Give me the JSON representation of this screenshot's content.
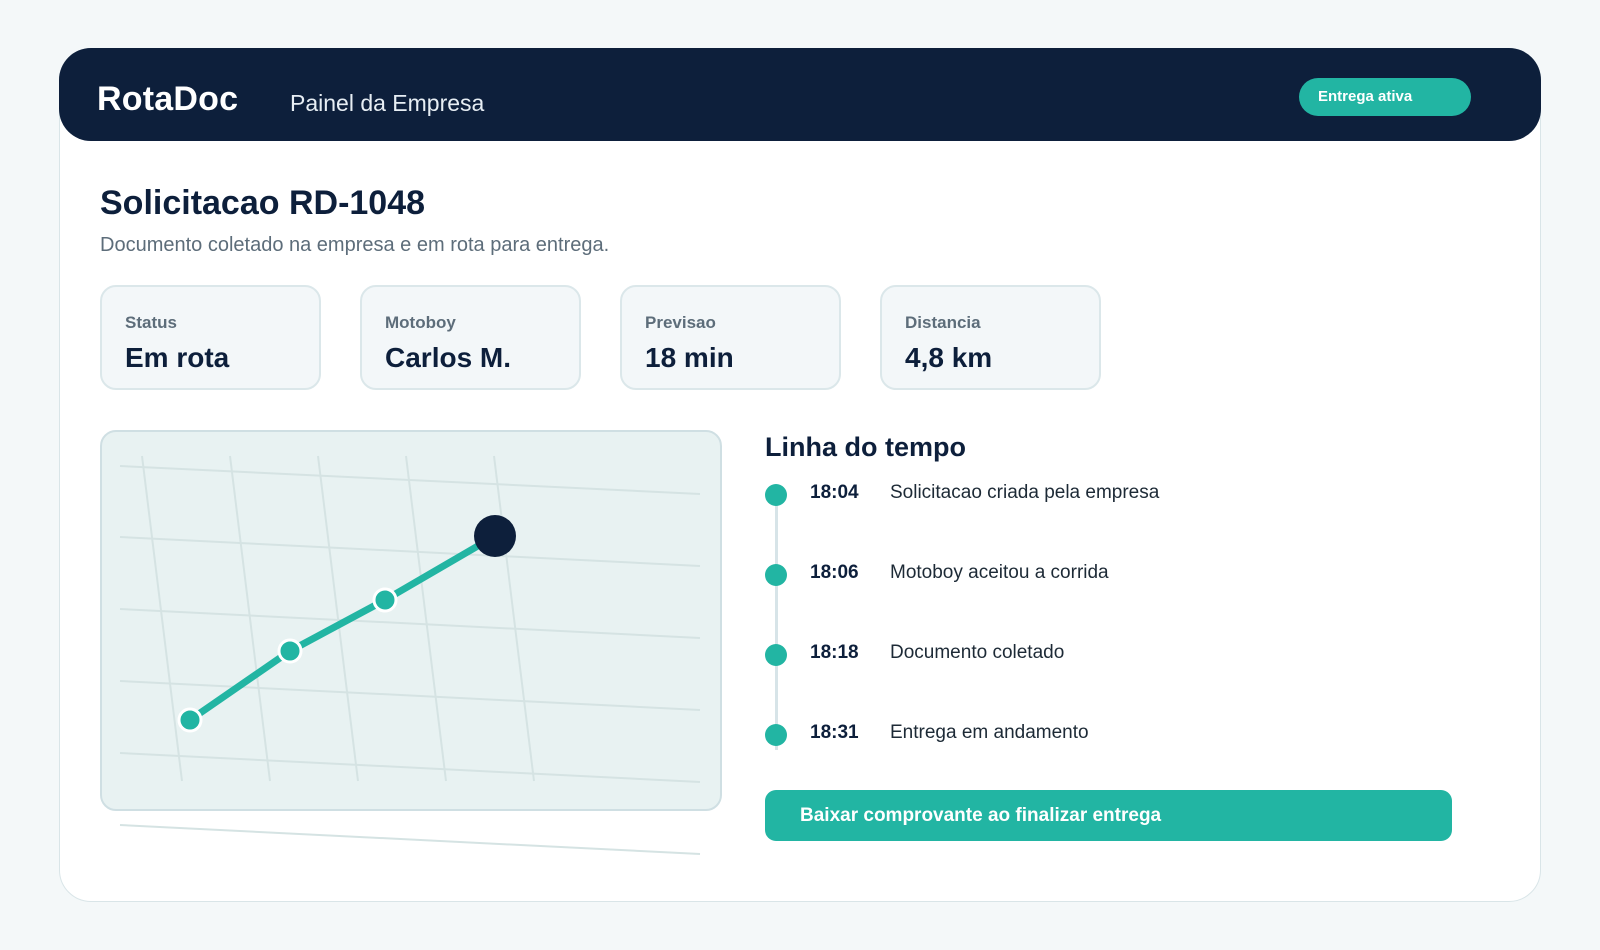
{
  "header": {
    "brand": "RotaDoc",
    "subtitle": "Painel da Empresa",
    "status_pill": "Entrega ativa"
  },
  "request": {
    "title": "Solicitacao RD-1048",
    "description": "Documento coletado na empresa e em rota para entrega."
  },
  "stats": [
    {
      "label": "Status",
      "value": "Em rota"
    },
    {
      "label": "Motoboy",
      "value": "Carlos M."
    },
    {
      "label": "Previsao",
      "value": "18 min"
    },
    {
      "label": "Distancia",
      "value": "4,8 km"
    }
  ],
  "map": {
    "route_color": "#22b5a3",
    "courier_marker_color": "#0d1f3b"
  },
  "timeline": {
    "title": "Linha do tempo",
    "events": [
      {
        "time": "18:04",
        "text": "Solicitacao criada pela empresa"
      },
      {
        "time": "18:06",
        "text": "Motoboy aceitou a corrida"
      },
      {
        "time": "18:18",
        "text": "Documento coletado"
      },
      {
        "time": "18:31",
        "text": "Entrega em andamento"
      }
    ]
  },
  "cta": {
    "label": "Baixar comprovante ao finalizar entrega"
  },
  "colors": {
    "navy": "#0d1f3b",
    "accent": "#22b5a3",
    "muted_text": "#5d6d7a"
  }
}
